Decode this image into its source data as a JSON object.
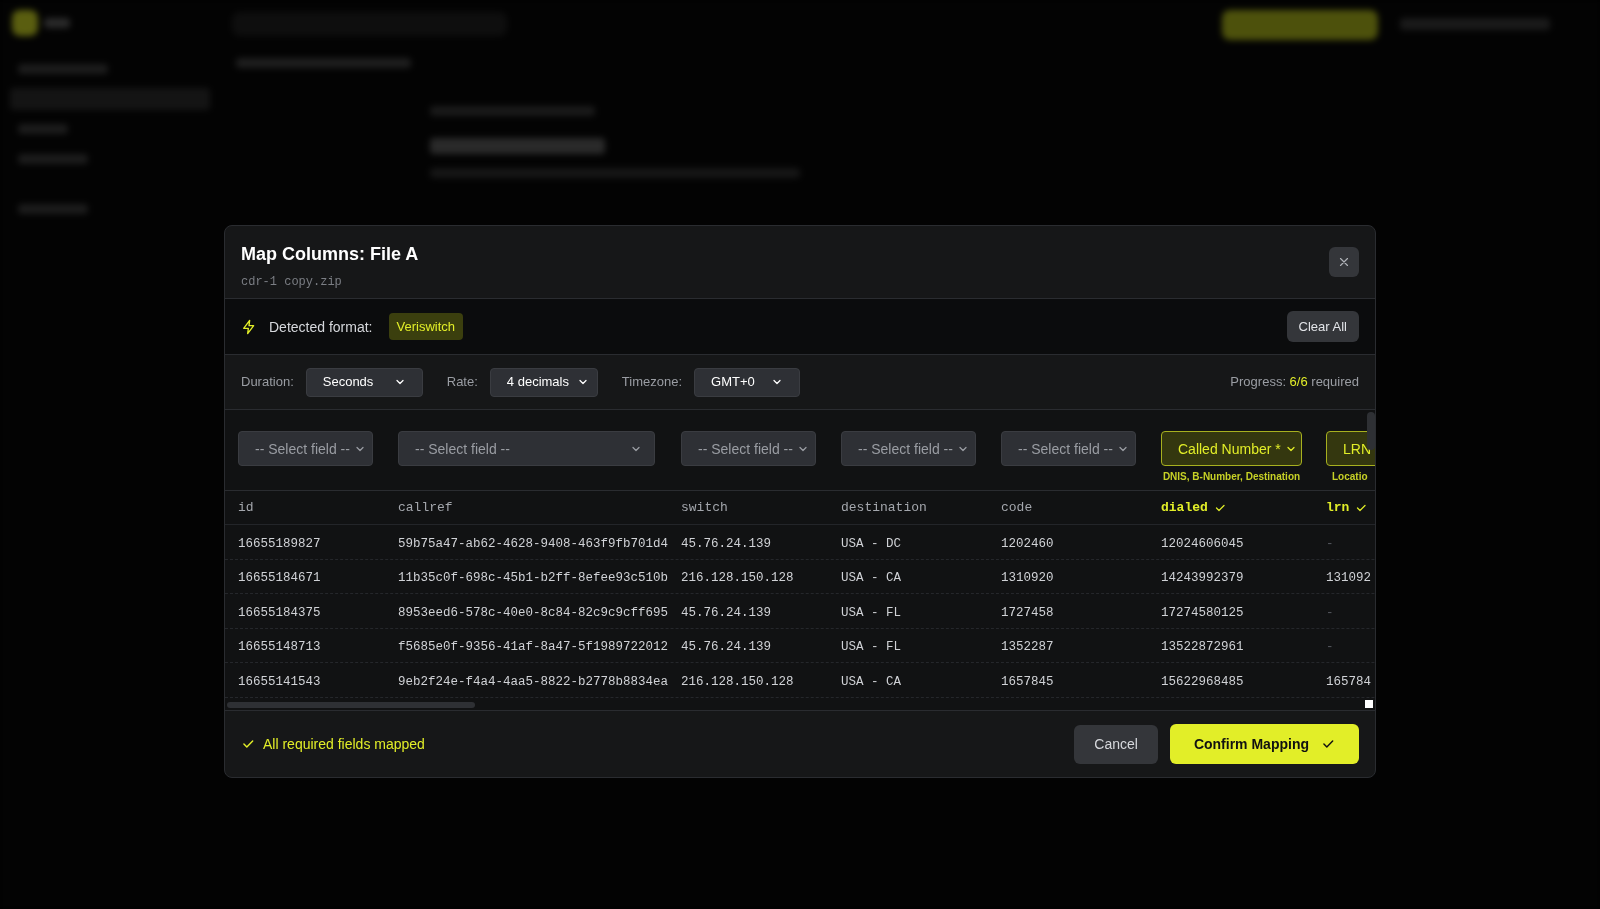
{
  "modal": {
    "title": "Map Columns: File A",
    "filename": "cdr-1 copy.zip",
    "detected_label": "Detected format:",
    "detected_format": "Veriswitch",
    "clear_all": "Clear All",
    "options": [
      {
        "label": "Duration:",
        "value": "Seconds"
      },
      {
        "label": "Rate:",
        "value": "4 decimals"
      },
      {
        "label": "Timezone:",
        "value": "GMT+0"
      }
    ],
    "progress": {
      "label": "Progress:",
      "value": "6/6",
      "suffix": "required"
    },
    "columns": [
      {
        "header": "id",
        "mapped": false,
        "field": "-- Select field --"
      },
      {
        "header": "callref",
        "mapped": false,
        "field": "-- Select field --"
      },
      {
        "header": "switch",
        "mapped": false,
        "field": "-- Select field --"
      },
      {
        "header": "destination",
        "mapped": false,
        "field": "-- Select field --"
      },
      {
        "header": "code",
        "mapped": false,
        "field": "-- Select field --"
      },
      {
        "header": "dialed",
        "mapped": true,
        "field": "Called Number *",
        "hint": "DNIS, B-Number, Destination"
      },
      {
        "header": "lrn",
        "mapped": true,
        "field": "LRN",
        "hint": "Locatio"
      }
    ],
    "rows": [
      [
        "16655189827",
        "59b75a47-ab62-4628-9408-463f9fb701d4",
        "45.76.24.139",
        "USA - DC",
        "1202460",
        "12024606045",
        "-"
      ],
      [
        "16655184671",
        "11b35c0f-698c-45b1-b2ff-8efee93c510b",
        "216.128.150.128",
        "USA - CA",
        "1310920",
        "14243992379",
        "131092"
      ],
      [
        "16655184375",
        "8953eed6-578c-40e0-8c84-82c9c9cff695",
        "45.76.24.139",
        "USA - FL",
        "1727458",
        "17274580125",
        "-"
      ],
      [
        "16655148713",
        "f5685e0f-9356-41af-8a47-5f1989722012",
        "45.76.24.139",
        "USA - FL",
        "1352287",
        "13522872961",
        "-"
      ],
      [
        "16655141543",
        "9eb2f24e-f4a4-4aa5-8822-b2778b8834ea",
        "216.128.150.128",
        "USA - CA",
        "1657845",
        "15622968485",
        "165784"
      ]
    ],
    "status": "All required fields mapped",
    "cancel": "Cancel",
    "confirm": "Confirm Mapping"
  }
}
